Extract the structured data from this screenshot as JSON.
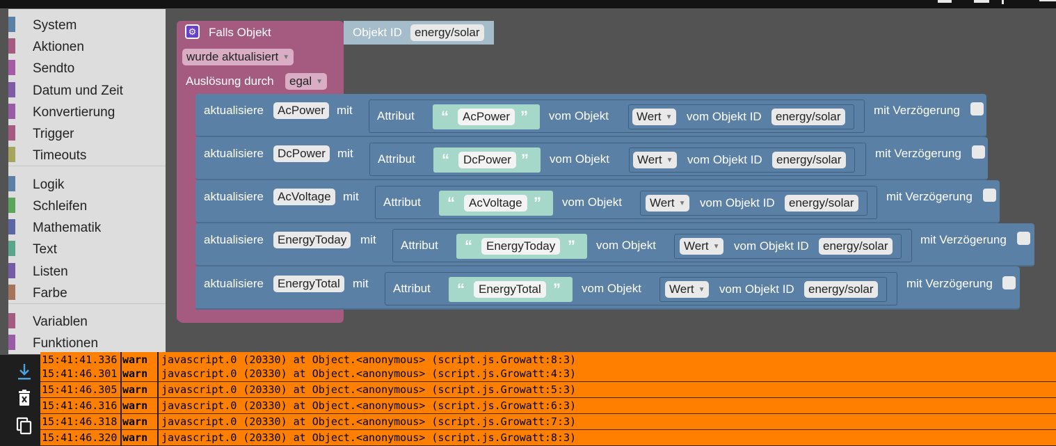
{
  "toolbox": {
    "categories": [
      {
        "label": "System",
        "color": "#5b80a5"
      },
      {
        "label": "Aktionen",
        "color": "#a55b80"
      },
      {
        "label": "Sendto",
        "color": "#a55ba5"
      },
      {
        "label": "Datum und Zeit",
        "color": "#805ba5"
      },
      {
        "label": "Konvertierung",
        "color": "#995ba5"
      },
      {
        "label": "Trigger",
        "color": "#a55b80"
      },
      {
        "label": "Timeouts",
        "color": "#a5a55b"
      },
      {
        "label": "Logik",
        "color": "#5b80a5"
      },
      {
        "label": "Schleifen",
        "color": "#5ba55b"
      },
      {
        "label": "Mathematik",
        "color": "#5b67a5"
      },
      {
        "label": "Text",
        "color": "#5ba58c"
      },
      {
        "label": "Listen",
        "color": "#745ba5"
      },
      {
        "label": "Farbe",
        "color": "#a5745b"
      },
      {
        "label": "Variablen",
        "color": "#a55b80"
      },
      {
        "label": "Funktionen",
        "color": "#995ba5"
      }
    ]
  },
  "trigger": {
    "title": "Falls Objekt",
    "condition": "wurde aktualisiert",
    "ausloesung_label": "Auslösung durch",
    "ausloesung_value": "egal",
    "object_label": "Objekt ID",
    "object_id": "energy/solar",
    "trigger_color": "#a55b80",
    "action_color": "#5b80a5",
    "string_color": "#a5d8c8"
  },
  "rows": [
    {
      "update": "aktualisiere",
      "name": "AcPower",
      "mit": "mit",
      "attribut": "Attribut",
      "attr_value": "AcPower",
      "vom_objekt": "vom Objekt",
      "wert": "Wert",
      "vom_objekt_id": "vom Objekt ID",
      "object_id": "energy/solar",
      "delay": "mit Verzögerung"
    },
    {
      "update": "aktualisiere",
      "name": "DcPower",
      "mit": "mit",
      "attribut": "Attribut",
      "attr_value": "DcPower",
      "vom_objekt": "vom Objekt",
      "wert": "Wert",
      "vom_objekt_id": "vom Objekt ID",
      "object_id": "energy/solar",
      "delay": "mit Verzögerung"
    },
    {
      "update": "aktualisiere",
      "name": "AcVoltage",
      "mit": "mit",
      "attribut": "Attribut",
      "attr_value": "AcVoltage",
      "vom_objekt": "vom Objekt",
      "wert": "Wert",
      "vom_objekt_id": "vom Objekt ID",
      "object_id": "energy/solar",
      "delay": "mit Verzögerung"
    },
    {
      "update": "aktualisiere",
      "name": "EnergyToday",
      "mit": "mit",
      "attribut": "Attribut",
      "attr_value": "EnergyToday",
      "vom_objekt": "vom Objekt",
      "wert": "Wert",
      "vom_objekt_id": "vom Objekt ID",
      "object_id": "energy/solar",
      "delay": "mit Verzögerung"
    },
    {
      "update": "aktualisiere",
      "name": "EnergyTotal",
      "mit": "mit",
      "attribut": "Attribut",
      "attr_value": "EnergyTotal",
      "vom_objekt": "vom Objekt",
      "wert": "Wert",
      "vom_objekt_id": "vom Objekt ID",
      "object_id": "energy/solar",
      "delay": "mit Verzögerung"
    }
  ],
  "log": {
    "row_color": "#ff8000",
    "entries": [
      {
        "time": "15:41:41.336",
        "level": "warn",
        "message": "javascript.0 (20330) at Object.<anonymous> (script.js.Growatt:8:3)"
      },
      {
        "time": "15:41:46.301",
        "level": "warn",
        "message": "javascript.0 (20330) at Object.<anonymous> (script.js.Growatt:4:3)"
      },
      {
        "time": "15:41:46.305",
        "level": "warn",
        "message": "javascript.0 (20330) at Object.<anonymous> (script.js.Growatt:5:3)"
      },
      {
        "time": "15:41:46.316",
        "level": "warn",
        "message": "javascript.0 (20330) at Object.<anonymous> (script.js.Growatt:6:3)"
      },
      {
        "time": "15:41:46.318",
        "level": "warn",
        "message": "javascript.0 (20330) at Object.<anonymous> (script.js.Growatt:7:3)"
      },
      {
        "time": "15:41:46.320",
        "level": "warn",
        "message": "javascript.0 (20330) at Object.<anonymous> (script.js.Growatt:8:3)"
      }
    ]
  }
}
